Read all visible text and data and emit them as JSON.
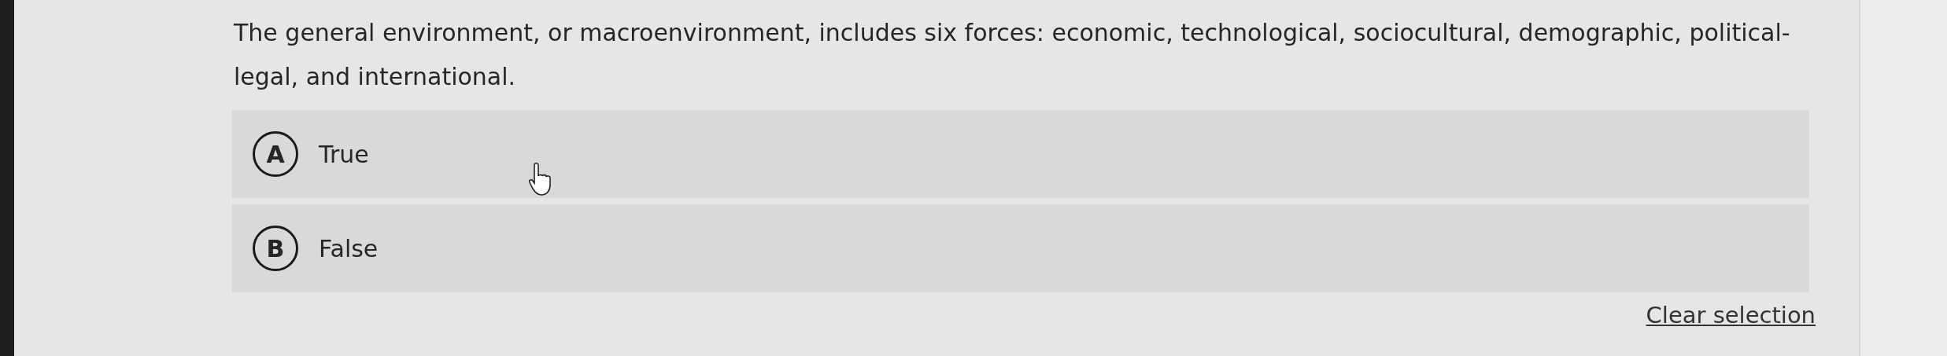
{
  "question": "The general environment, or macroenvironment, includes six forces: economic, technological, sociocultural, demographic, political-legal, and international.",
  "options": [
    {
      "letter": "A",
      "label": "True",
      "selected": false
    },
    {
      "letter": "B",
      "label": "False",
      "selected": false
    }
  ],
  "clear_link": "Clear selection"
}
